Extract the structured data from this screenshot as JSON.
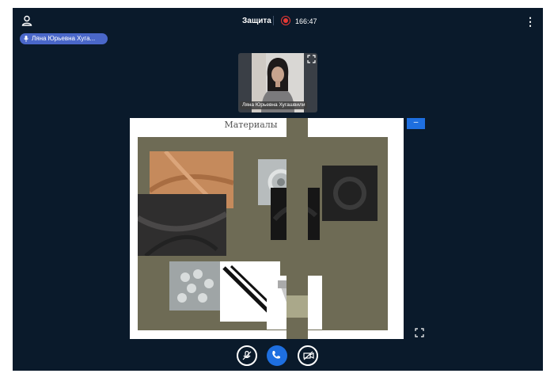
{
  "header": {
    "title": "Защита",
    "timer": "166:47"
  },
  "speaker": {
    "name": "Ляна Юрьевна Хуга..."
  },
  "participant": {
    "name": "Ляна Юрьевна Хугашвили"
  },
  "slide": {
    "title": "Материалы"
  },
  "icons": {
    "user": "user-icon",
    "more": "more-vertical-icon",
    "record": "record-icon",
    "mic": "microphone-icon",
    "expand": "expand-icon",
    "minimize": "minimize-icon",
    "mic_off": "mic-off-icon",
    "phone": "phone-icon",
    "camera_off": "camera-off-icon"
  },
  "colors": {
    "background": "#0a1a2b",
    "accent": "#1e6fe0",
    "speaker_badge": "#4a67c9",
    "record": "#e53935",
    "slide_panel": "#6e6b55"
  }
}
